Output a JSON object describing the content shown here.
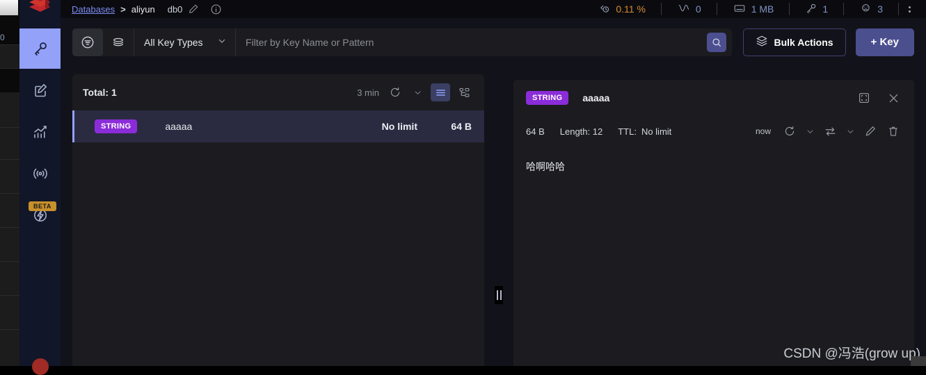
{
  "background_window": {
    "metric_value": "0"
  },
  "colors": {
    "accent_blue": "#93a1f9",
    "brand_red": "#a02c25",
    "string_badge_purple": "#8b2cd9",
    "primary_button": "#4b4f8e",
    "panel_bg": "#1c1c20",
    "app_bg": "#12121a",
    "rail_bg": "#111629",
    "selected_row_bg": "#2a2b40",
    "beta_badge": "#c8902a",
    "cpu_orange": "#d98b35"
  },
  "sidebar": {
    "logo_name": "redis-logo",
    "items": [
      {
        "name": "browser",
        "icon": "key-icon",
        "active": true
      },
      {
        "name": "workbench",
        "icon": "edit-square-icon",
        "active": false
      },
      {
        "name": "analysis-tools",
        "icon": "bar-chart-icon",
        "active": false
      },
      {
        "name": "pub-sub",
        "icon": "broadcast-icon",
        "active": false
      },
      {
        "name": "triggers-and-functions",
        "icon": "lightning-gear-icon",
        "active": false,
        "badge": "BETA"
      }
    ],
    "beta_label": "BETA"
  },
  "topbar": {
    "databases_link": "Databases",
    "separator": ">",
    "database_alias": "aliyun",
    "db_index": "db0",
    "edit_icon": "pencil-icon",
    "info_icon": "info-circle-icon",
    "metrics": [
      {
        "name": "cpu",
        "icon": "cpu-gauge-icon",
        "value": "0.11 %",
        "accent": "orange"
      },
      {
        "name": "commands-per-second",
        "icon": "activity-line-icon",
        "value": "0",
        "accent": "blue"
      },
      {
        "name": "memory-used",
        "icon": "memory-chip-icon",
        "value": "1 MB",
        "accent": "blue"
      },
      {
        "name": "total-keys",
        "icon": "key-small-icon",
        "value": "1",
        "accent": "blue"
      },
      {
        "name": "connected-clients",
        "icon": "user-icon",
        "value": "3",
        "accent": "blue"
      }
    ],
    "kebab_icon": "more-vertical-icon"
  },
  "toolbar": {
    "filter_mode_icon": "filter-icon",
    "scan_mode_icon": "layers-stack-icon",
    "key_type_selected": "All Key Types",
    "key_type_chevron_icon": "chevron-down-icon",
    "filter_placeholder": "Filter by Key Name or Pattern",
    "filter_value": "",
    "search_icon": "search-icon",
    "bulk_actions_label": "Bulk Actions",
    "bulk_actions_icon": "layers-icon",
    "add_key_label": "+ Key"
  },
  "keys_panel": {
    "total_label": "Total: 1",
    "refresh_time": "3 min",
    "refresh_icon": "refresh-icon",
    "refresh_chevron_icon": "chevron-down-icon",
    "view_list_icon": "list-view-icon",
    "view_tree_icon": "tree-view-icon",
    "rows": [
      {
        "type": "STRING",
        "name": "aaaaa",
        "ttl": "No limit",
        "size": "64 B",
        "selected": true
      }
    ]
  },
  "splitter": {
    "name": "panel-splitter",
    "handle_icon": "drag-handle-icon"
  },
  "details_panel": {
    "type_badge": "STRING",
    "key_name": "aaaaa",
    "fullscreen_icon": "fullscreen-icon",
    "close_icon": "close-icon",
    "size": "64 B",
    "length_label": "Length: 12",
    "ttl_label": "TTL:",
    "ttl_value": "No limit",
    "now_label": "now",
    "refresh_icon": "refresh-icon",
    "refresh_chevron_icon": "chevron-down-icon",
    "format_icon": "swap-format-icon",
    "format_chevron_icon": "chevron-down-icon",
    "edit_icon": "pencil-icon",
    "delete_icon": "trash-icon",
    "value": "哈啊哈哈"
  },
  "watermark": {
    "text": "CSDN @冯浩(grow up)"
  }
}
